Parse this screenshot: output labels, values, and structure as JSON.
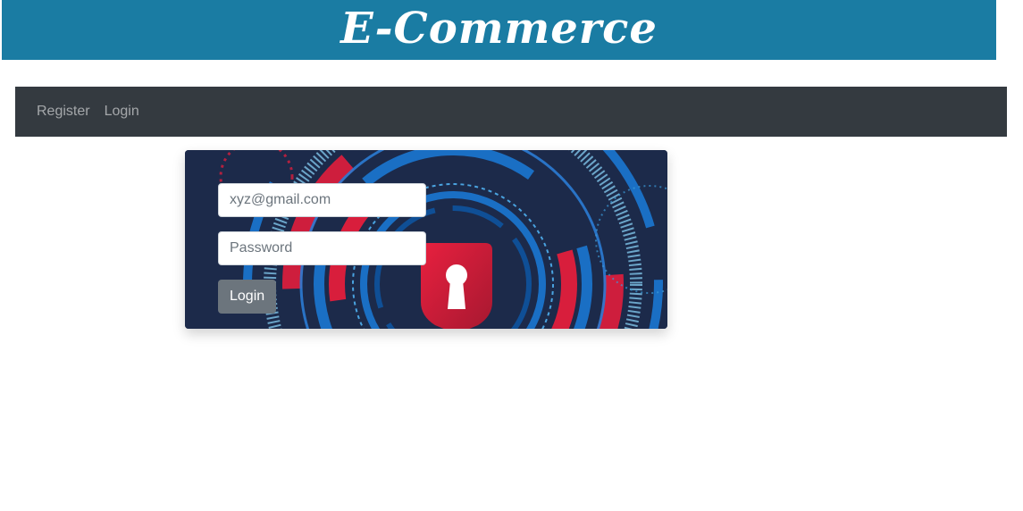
{
  "header": {
    "title": "E-Commerce"
  },
  "nav": {
    "items": [
      {
        "label": "Register"
      },
      {
        "label": "Login"
      }
    ]
  },
  "login_form": {
    "email_placeholder": "xyz@gmail.com",
    "password_placeholder": "Password",
    "submit_label": "Login"
  },
  "colors": {
    "banner": "#1a7ca3",
    "navbar": "#343a40",
    "card_background": "#1c2a4a",
    "accent_red": "#d81e3c",
    "accent_blue": "#1a6fc4",
    "button": "#6c757d"
  },
  "icons": {
    "card_art": "security-lock-icon"
  }
}
